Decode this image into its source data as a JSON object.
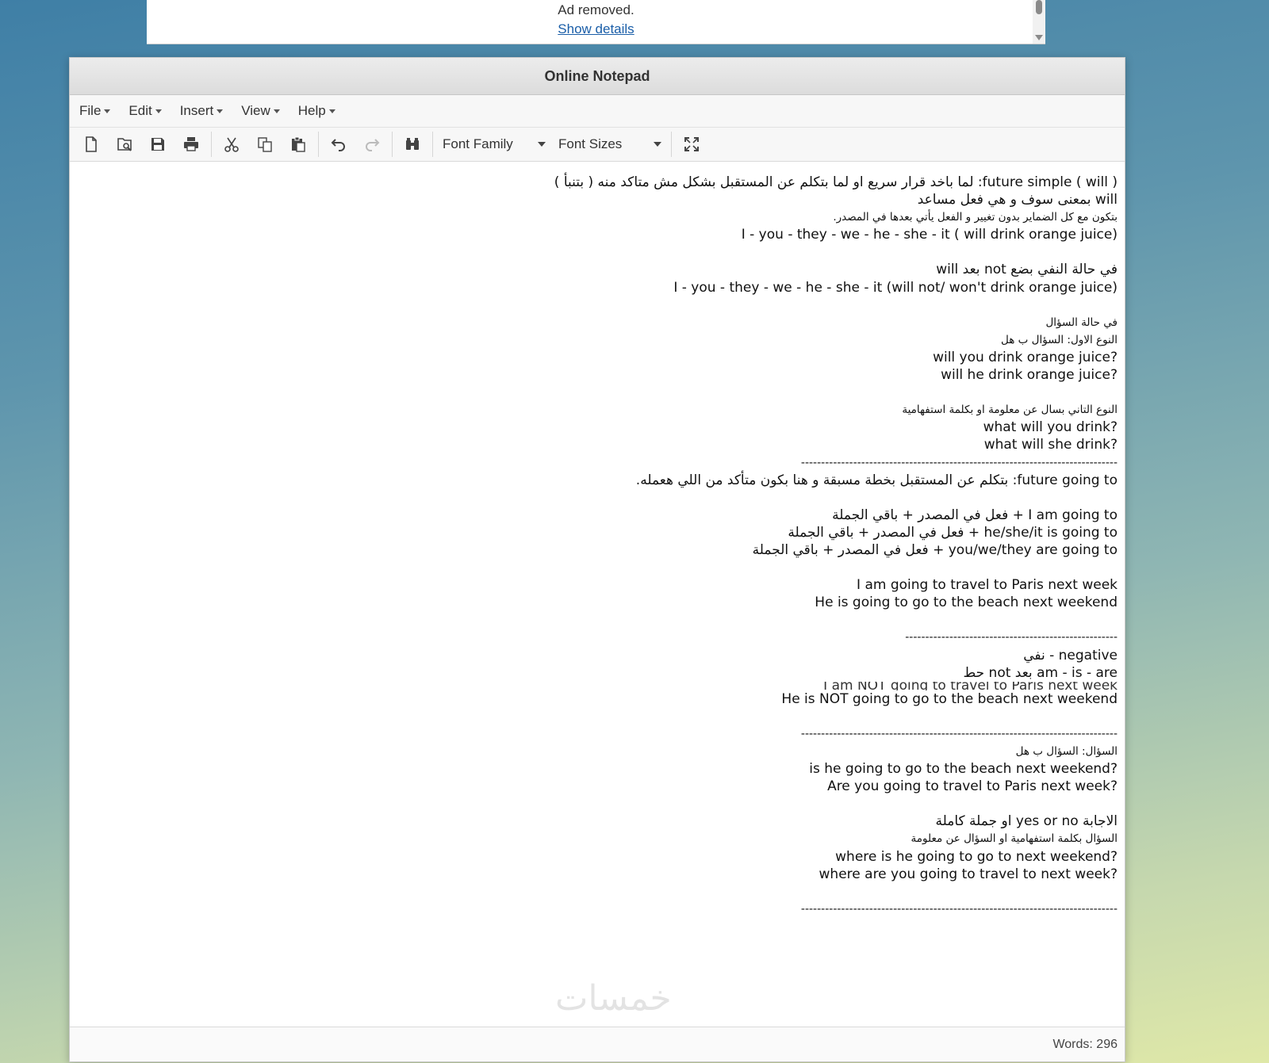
{
  "ad": {
    "message": "Ad removed.",
    "details_link": "Show details"
  },
  "window": {
    "title": "Online Notepad"
  },
  "menus": [
    "File",
    "Edit",
    "Insert",
    "View",
    "Help"
  ],
  "toolbar": {
    "buttons": [
      "new-doc-icon",
      "open-icon",
      "save-icon",
      "print-icon",
      "cut-icon",
      "copy-icon",
      "paste-icon",
      "undo-icon",
      "redo-icon",
      "find-icon",
      "fullscreen-icon"
    ],
    "font_family_label": "Font Family",
    "font_sizes_label": "Font Sizes"
  },
  "document": {
    "lines": [
      "future simple ( will ): لما باخد قرار سريع او لما بتكلم عن المستقبل بشكل مش متاكد منه ( بتنبأ )",
      "will بمعنى سوف و هي فعل مساعد",
      "بتكون مع كل الضماير بدون تغيير و الفعل يأتي بعدها في المصدر.",
      "I - you - they - we - he - she - it ( will drink orange juice)",
      "",
      "في حالة النفي بضع not بعد will",
      "I - you - they - we - he - she - it (will not/ won't drink orange juice)",
      "",
      "في حالة السؤال",
      "النوع الاول: السؤال ب هل",
      "?will you drink orange juice",
      "?will he drink orange juice",
      "",
      "النوع التاني بسال عن معلومة او بكلمة استفهامية",
      "?what will you drink",
      "?what will she drink",
      "-------------------------------------------------------------------------------",
      "future going to: بتكلم عن المستقبل بخطة مسبقة و هنا بكون متأكد من اللي هعمله.",
      "",
      "I am going to + فعل في المصدر + باقي الجملة",
      "he/she/it is going to + فعل في المصدر + باقي الجملة",
      "you/we/they are going to + فعل في المصدر + باقي الجملة",
      "",
      "I am going to travel to Paris next week",
      "He is going to go to the beach next weekend",
      "",
      "-----------------------------------------------------",
      "negative - نفي",
      "am - is - are بعد not حط",
      "I am NOT going to travel to Paris next week",
      "He is NOT going to go to the beach next weekend",
      "",
      "-------------------------------------------------------------------------------",
      "السؤال: السؤال ب هل",
      "?is he going to go to the beach next weekend",
      "?Are you going to travel to Paris next week",
      "",
      "الاجابة yes or no او جملة كاملة",
      "السؤال بكلمة استفهامية او السؤال عن معلومة",
      "?where is he going to go to next weekend",
      "?where are you going to travel to next week",
      "",
      "-------------------------------------------------------------------------------"
    ]
  },
  "status": {
    "words": "Words: 296"
  },
  "watermark": "خمسات"
}
